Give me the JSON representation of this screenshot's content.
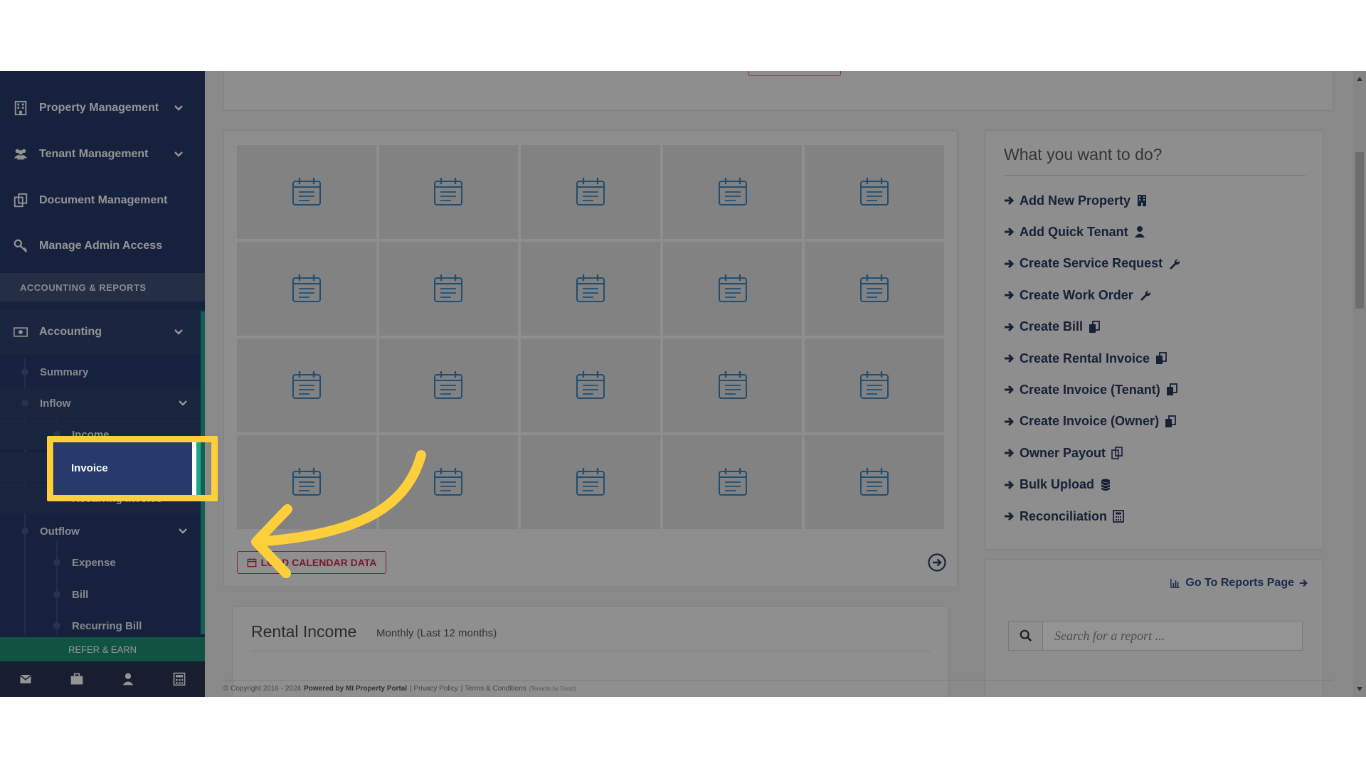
{
  "sidebar": {
    "items": [
      {
        "label": "Property Management"
      },
      {
        "label": "Tenant Management"
      },
      {
        "label": "Document Management"
      },
      {
        "label": "Manage Admin Access"
      }
    ],
    "section_heading": "ACCOUNTING & REPORTS",
    "accounting": {
      "label": "Accounting",
      "summary": "Summary",
      "inflow": "Inflow",
      "income": "Income",
      "invoice": "Invoice",
      "recurring_invoice": "Recurring Invoice",
      "outflow": "Outflow",
      "expense": "Expense",
      "bill": "Bill",
      "recurring_bill": "Recurring Bill"
    },
    "refer_label": "REFER & EARN",
    "bottom_icons": [
      "envelope-icon",
      "briefcase-icon",
      "user-icon",
      "calculator-icon"
    ]
  },
  "calendar": {
    "load_button": "LOAD CALENDAR DATA"
  },
  "todo": {
    "title": "What you want to do?",
    "items": [
      {
        "label": "Add New Property",
        "icon": "building-icon"
      },
      {
        "label": "Add Quick Tenant",
        "icon": "user-icon"
      },
      {
        "label": "Create Service Request",
        "icon": "wrench-icon"
      },
      {
        "label": "Create Work Order",
        "icon": "wrench-icon"
      },
      {
        "label": "Create Bill",
        "icon": "copy-icon"
      },
      {
        "label": "Create Rental Invoice",
        "icon": "copy-icon"
      },
      {
        "label": "Create Invoice (Tenant)",
        "icon": "copy-icon"
      },
      {
        "label": "Create Invoice (Owner)",
        "icon": "copy-icon"
      },
      {
        "label": "Owner Payout",
        "icon": "copy-outline-icon"
      },
      {
        "label": "Bulk Upload",
        "icon": "database-icon"
      },
      {
        "label": "Reconciliation",
        "icon": "calculator-icon"
      }
    ]
  },
  "reports": {
    "link": "Go To Reports Page",
    "search_placeholder": "Search for a report ..."
  },
  "rental": {
    "title": "Rental Income",
    "subtitle": "Monthly (Last 12 months)"
  },
  "footer": {
    "copyright": "© Copyright 2016 - 2024",
    "powered": "Powered by MI Property Portal",
    "privacy": "| Privacy Policy",
    "terms": "| Terms & Conditions",
    "tenants": "(Tenants by Good)"
  },
  "colors": {
    "sidebar": "#273a6b",
    "accent": "#1fa58e",
    "highlight": "#fdd03b",
    "load_button": "#c9304d"
  }
}
